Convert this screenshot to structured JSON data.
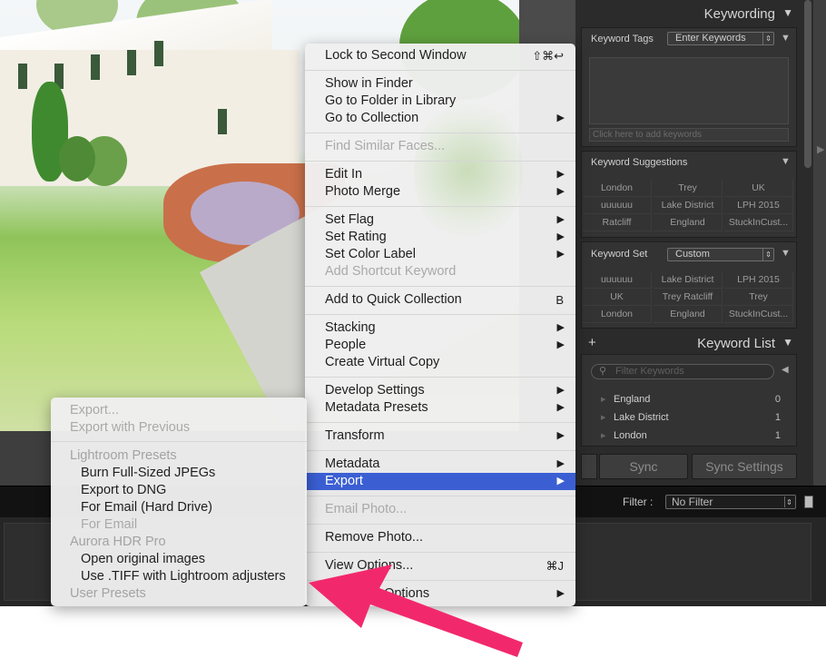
{
  "context_menu": {
    "items": [
      {
        "label": "Lock to Second Window",
        "shortcut": "⇧⌘↩"
      },
      {
        "label": "Show in Finder"
      },
      {
        "label": "Go to Folder in Library"
      },
      {
        "label": "Go to Collection",
        "submenu": "▶"
      },
      {
        "label": "Find Similar Faces...",
        "disabled": true
      },
      {
        "label": "Edit In",
        "submenu": "▶"
      },
      {
        "label": "Photo Merge",
        "submenu": "▶"
      },
      {
        "label": "Set Flag",
        "submenu": "▶"
      },
      {
        "label": "Set Rating",
        "submenu": "▶"
      },
      {
        "label": "Set Color Label",
        "submenu": "▶"
      },
      {
        "label": "Add Shortcut Keyword",
        "disabled": true
      },
      {
        "label": "Add to Quick Collection",
        "shortcut": "B"
      },
      {
        "label": "Stacking",
        "submenu": "▶"
      },
      {
        "label": "People",
        "submenu": "▶"
      },
      {
        "label": "Create Virtual Copy"
      },
      {
        "label": "Develop Settings",
        "submenu": "▶"
      },
      {
        "label": "Metadata Presets",
        "submenu": "▶"
      },
      {
        "label": "Transform",
        "submenu": "▶"
      },
      {
        "label": "Metadata",
        "submenu": "▶"
      },
      {
        "label": "Export",
        "submenu": "▶",
        "selected": true
      },
      {
        "label": "Email Photo...",
        "disabled": true
      },
      {
        "label": "Remove Photo..."
      },
      {
        "label": "View Options...",
        "shortcut": "⌘J"
      },
      {
        "label": "d Options",
        "submenu": "▶"
      }
    ]
  },
  "export_submenu": {
    "items": [
      {
        "label": "Export...",
        "disabled": true
      },
      {
        "label": "Export with Previous",
        "disabled": true
      },
      {
        "label": "Lightroom Presets",
        "header": true
      },
      {
        "label": "Burn Full-Sized JPEGs"
      },
      {
        "label": "Export to DNG"
      },
      {
        "label": "For Email (Hard Drive)"
      },
      {
        "label": "For Email",
        "disabled": true
      },
      {
        "label": "Aurora HDR Pro",
        "header": true
      },
      {
        "label": "Open original images"
      },
      {
        "label": "Use .TIFF with Lightroom adjusters"
      },
      {
        "label": "User Presets",
        "header": true
      }
    ]
  },
  "right_panel": {
    "keywording": {
      "title": "Keywording",
      "tags_label": "Keyword Tags",
      "tags_mode": "Enter Keywords",
      "add_placeholder": "Click here to add keywords"
    },
    "suggestions": {
      "title": "Keyword Suggestions",
      "items": [
        "London",
        "Trey",
        "UK",
        "uuuuuu",
        "Lake District",
        "LPH 2015",
        "Ratcliff",
        "England",
        "StuckInCust..."
      ]
    },
    "keyword_set": {
      "label": "Keyword Set",
      "value": "Custom",
      "items": [
        "uuuuuu",
        "Lake District",
        "LPH 2015",
        "UK",
        "Trey Ratcliff",
        "Trey",
        "London",
        "England",
        "StuckInCust..."
      ]
    },
    "keyword_list": {
      "title": "Keyword List",
      "add_icon": "+",
      "filter_placeholder": "Filter Keywords",
      "rows": [
        {
          "name": "England",
          "count": "0"
        },
        {
          "name": "Lake District",
          "count": "1"
        },
        {
          "name": "London",
          "count": "1"
        }
      ]
    },
    "sync": {
      "sync_label": "Sync",
      "sync_settings_label": "Sync Settings"
    }
  },
  "filter_bar": {
    "label": "Filter :",
    "value": "No Filter"
  },
  "colors": {
    "selection": "#3b5fd3",
    "annotation_arrow": "#f2286d",
    "panel": "#2b2b2b"
  }
}
